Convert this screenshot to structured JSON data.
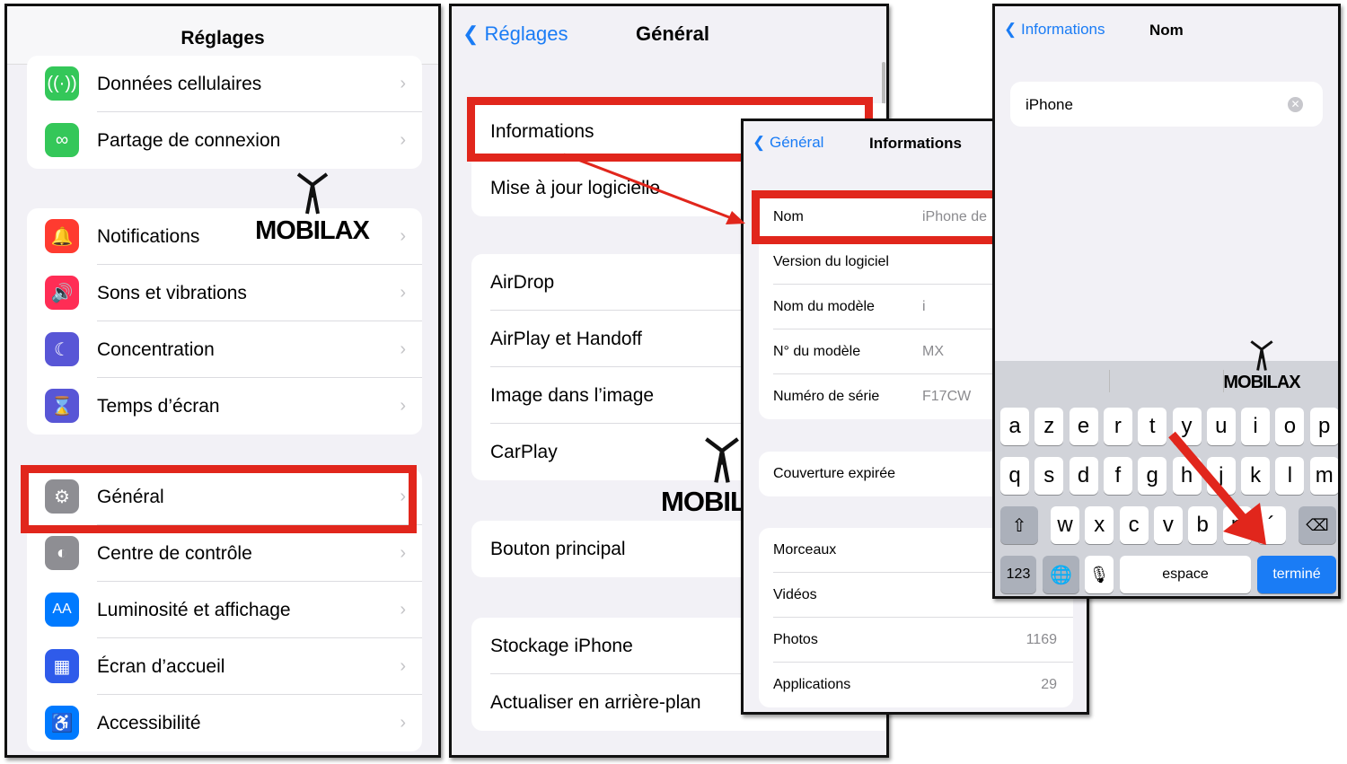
{
  "settings": {
    "title": "Réglages",
    "groups": [
      [
        {
          "label": "Données cellulaires",
          "icon": "antenna-icon",
          "glyph": "((·))",
          "color": "#34c759"
        },
        {
          "label": "Partage de connexion",
          "icon": "link-icon",
          "glyph": "∞",
          "color": "#34c759"
        }
      ],
      [
        {
          "label": "Notifications",
          "icon": "bell-icon",
          "glyph": "🔔",
          "color": "#ff3b30"
        },
        {
          "label": "Sons et vibrations",
          "icon": "speaker-icon",
          "glyph": "🔊",
          "color": "#ff2d55"
        },
        {
          "label": "Concentration",
          "icon": "moon-icon",
          "glyph": "☾",
          "color": "#5856d6"
        },
        {
          "label": "Temps d’écran",
          "icon": "hourglass-icon",
          "glyph": "⌛",
          "color": "#5856d6"
        }
      ],
      [
        {
          "label": "Général",
          "icon": "gear-icon",
          "glyph": "⚙",
          "color": "#8e8e93"
        },
        {
          "label": "Centre de contrôle",
          "icon": "toggles-icon",
          "glyph": "◐",
          "color": "#8e8e93"
        },
        {
          "label": "Luminosité et affichage",
          "icon": "text-size-icon",
          "glyph": "AA",
          "color": "#007aff"
        },
        {
          "label": "Écran d’accueil",
          "icon": "home-grid-icon",
          "glyph": "▦",
          "color": "#2f5bea"
        },
        {
          "label": "Accessibilité",
          "icon": "accessibility-icon",
          "glyph": "♿",
          "color": "#007aff"
        }
      ]
    ]
  },
  "general": {
    "back": "Réglages",
    "title": "Général",
    "groups": [
      [
        "Informations",
        "Mise à jour logicielle"
      ],
      [
        "AirDrop",
        "AirPlay et Handoff",
        "Image dans l’image",
        "CarPlay"
      ],
      [
        "Bouton principal"
      ],
      [
        "Stockage iPhone",
        "Actualiser en arrière-plan"
      ]
    ]
  },
  "info": {
    "back": "Général",
    "title": "Informations",
    "groups": [
      [
        {
          "label": "Nom",
          "value": "iPhone de"
        },
        {
          "label": "Version du logiciel",
          "value": ""
        },
        {
          "label": "Nom du modèle",
          "value": "i"
        },
        {
          "label": "N° du modèle",
          "value": "MX"
        },
        {
          "label": "Numéro de série",
          "value": "F17CW"
        }
      ],
      [
        {
          "label": "Couverture expirée",
          "value": ""
        }
      ],
      [
        {
          "label": "Morceaux",
          "value": ""
        },
        {
          "label": "Vidéos",
          "value": ""
        },
        {
          "label": "Photos",
          "value": "1169"
        },
        {
          "label": "Applications",
          "value": "29"
        }
      ]
    ]
  },
  "name": {
    "back": "Informations",
    "title": "Nom",
    "field_value": "iPhone ",
    "keyboard": {
      "row1": [
        "a",
        "z",
        "e",
        "r",
        "t",
        "y",
        "u",
        "i",
        "o",
        "p"
      ],
      "row2": [
        "q",
        "s",
        "d",
        "f",
        "g",
        "h",
        "j",
        "k",
        "l",
        "m"
      ],
      "row3": [
        "w",
        "x",
        "c",
        "v",
        "b",
        "n",
        "´"
      ],
      "numbers": "123",
      "space": "espace",
      "done": "terminé"
    }
  },
  "logo": "MOBILAX",
  "colors": {
    "accent": "#1a7cf5",
    "highlight": "#e1261c"
  }
}
